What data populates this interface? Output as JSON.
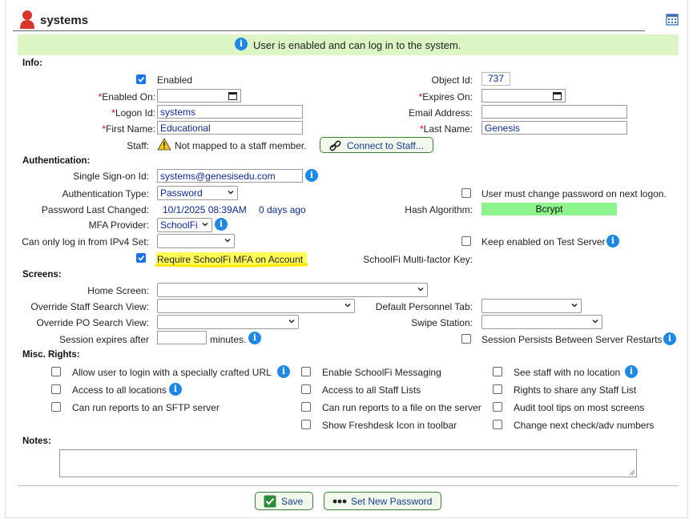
{
  "header": {
    "title": "systems",
    "calendar_icon": "calendar-icon",
    "user_icon": "user-icon"
  },
  "notice": {
    "text": "User is enabled and can log in to the system.",
    "icon": "info-icon"
  },
  "info": {
    "section": "Info:",
    "enabled_label": "Enabled",
    "object_id_label": "Object Id:",
    "object_id": "737",
    "enabled_on_label": "Enabled On:",
    "expires_on_label": "Expires On:",
    "logon_id_label": "Logon Id:",
    "logon_id": "systems",
    "email_label": "Email Address:",
    "email": "",
    "first_name_label": "First Name:",
    "first_name": "Educational",
    "last_name_label": "Last Name:",
    "last_name": "Genesis",
    "staff_label": "Staff:",
    "staff_text": "Not mapped to a staff member.",
    "connect_button": "Connect to Staff...",
    "required_mark": "*"
  },
  "auth": {
    "section": "Authentication:",
    "sso_label": "Single Sign-on Id:",
    "sso": "systems@genesisedu.com",
    "auth_type_label": "Authentication Type:",
    "auth_type": "Password",
    "must_change_label": "User must change password on next logon.",
    "pwd_changed_label": "Password Last Changed:",
    "pwd_changed": "10/1/2025 08:39AM",
    "pwd_days": "0 days ago",
    "hash_label": "Hash Algorithm:",
    "hash": "Bcrypt",
    "mfa_label": "MFA Provider:",
    "mfa": "SchoolFi",
    "ipv4_label": "Can only log in from IPv4 Set:",
    "keep_enabled_label": "Keep enabled on Test Server",
    "require_mfa_label": "Require SchoolFi MFA on Account",
    "mfa_key_label": "SchoolFi Multi-factor Key:"
  },
  "screens": {
    "section": "Screens:",
    "home_label": "Home Screen:",
    "staff_search_label": "Override Staff Search View:",
    "personnel_tab_label": "Default Personnel Tab:",
    "po_search_label": "Override PO Search View:",
    "swipe_label": "Swipe Station:",
    "session_label": "Session expires after",
    "minutes_label": "minutes.",
    "persist_label": "Session Persists Between Server Restarts"
  },
  "misc": {
    "section": "Misc. Rights:",
    "col1": [
      "Allow user to login with a specially crafted URL",
      "Access to all locations",
      "Can run reports to an SFTP server"
    ],
    "col2": [
      "Enable SchoolFi Messaging",
      "Access to all Staff Lists",
      "Can run reports to a file on the server",
      "Show Freshdesk Icon in toolbar"
    ],
    "col3": [
      "See staff with no location",
      "Rights to share any Staff List",
      "Audit tool tips on most screens",
      "Change next check/adv numbers"
    ]
  },
  "notes": {
    "label": "Notes:",
    "value": ""
  },
  "footer": {
    "save": "Save",
    "set_password": "Set New Password"
  },
  "colors": {
    "accent": "#1e88e5",
    "notice_bg": "#dcf5c4",
    "hash_bg": "#8ef48e",
    "highlight": "#ffff55",
    "required": "#dd0000"
  }
}
